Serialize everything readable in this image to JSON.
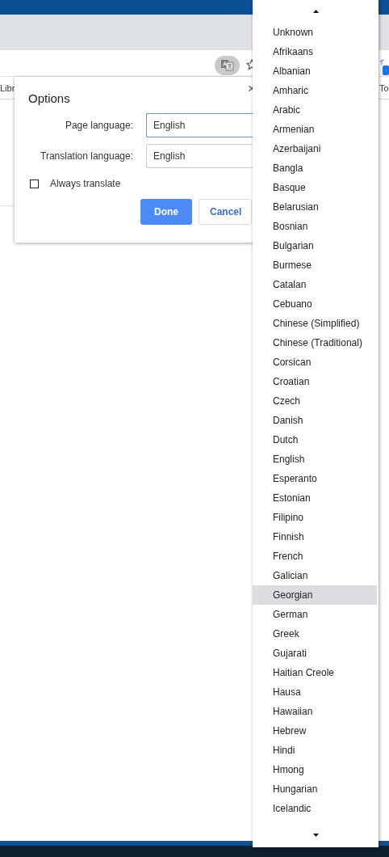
{
  "bookmarks": [
    {
      "label": "Libr",
      "kind": "left"
    },
    {
      "label": "To",
      "kind": "right"
    }
  ],
  "dialog": {
    "title": "Options",
    "close": "×",
    "fields": [
      {
        "label": "Page language:",
        "value": "English",
        "focused": true
      },
      {
        "label": "Translation language:",
        "value": "English",
        "focused": false
      }
    ],
    "always_translate": {
      "label": "Always translate",
      "checked": false
    },
    "buttons": [
      {
        "label": "Done",
        "kind": "primary"
      },
      {
        "label": "Cancel",
        "kind": "secondary"
      }
    ]
  },
  "language_list": {
    "items": [
      {
        "label": "Unknown",
        "selected": false
      },
      {
        "label": "Afrikaans",
        "selected": false
      },
      {
        "label": "Albanian",
        "selected": false
      },
      {
        "label": "Amharic",
        "selected": false
      },
      {
        "label": "Arabic",
        "selected": false
      },
      {
        "label": "Armenian",
        "selected": false
      },
      {
        "label": "Azerbaijani",
        "selected": false
      },
      {
        "label": "Bangla",
        "selected": false
      },
      {
        "label": "Basque",
        "selected": false
      },
      {
        "label": "Belarusian",
        "selected": false
      },
      {
        "label": "Bosnian",
        "selected": false
      },
      {
        "label": "Bulgarian",
        "selected": false
      },
      {
        "label": "Burmese",
        "selected": false
      },
      {
        "label": "Catalan",
        "selected": false
      },
      {
        "label": "Cebuano",
        "selected": false
      },
      {
        "label": "Chinese (Simplified)",
        "selected": false
      },
      {
        "label": "Chinese (Traditional)",
        "selected": false
      },
      {
        "label": "Corsican",
        "selected": false
      },
      {
        "label": "Croatian",
        "selected": false
      },
      {
        "label": "Czech",
        "selected": false
      },
      {
        "label": "Danish",
        "selected": false
      },
      {
        "label": "Dutch",
        "selected": false
      },
      {
        "label": "English",
        "selected": false
      },
      {
        "label": "Esperanto",
        "selected": false
      },
      {
        "label": "Estonian",
        "selected": false
      },
      {
        "label": "Filipino",
        "selected": false
      },
      {
        "label": "Finnish",
        "selected": false
      },
      {
        "label": "French",
        "selected": false
      },
      {
        "label": "Galician",
        "selected": false
      },
      {
        "label": "Georgian",
        "selected": true
      },
      {
        "label": "German",
        "selected": false
      },
      {
        "label": "Greek",
        "selected": false
      },
      {
        "label": "Gujarati",
        "selected": false
      },
      {
        "label": "Haitian Creole",
        "selected": false
      },
      {
        "label": "Hausa",
        "selected": false
      },
      {
        "label": "Hawaiian",
        "selected": false
      },
      {
        "label": "Hebrew",
        "selected": false
      },
      {
        "label": "Hindi",
        "selected": false
      },
      {
        "label": "Hmong",
        "selected": false
      },
      {
        "label": "Hungarian",
        "selected": false
      },
      {
        "label": "Icelandic",
        "selected": false
      }
    ]
  }
}
